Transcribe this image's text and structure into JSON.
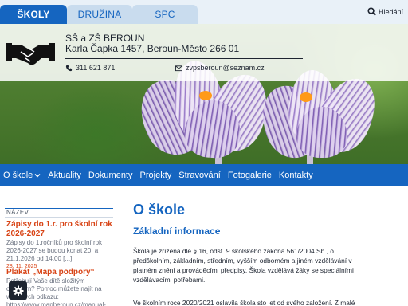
{
  "tabs": [
    {
      "label": "ŠKOLY",
      "active": true
    },
    {
      "label": "DRUŽINA",
      "active": false
    },
    {
      "label": "SPC",
      "active": false
    }
  ],
  "search": {
    "label": "Hledání",
    "icon": "search-icon"
  },
  "header": {
    "name": "SŠ a ZŠ BEROUN",
    "address": "Karla Čapka 1457, Beroun-Město 266 01",
    "phone": "311 621 871",
    "email": "zvpsberoun@seznam.cz",
    "logo_icon": "handshake-icon"
  },
  "nav": [
    {
      "label": "O škole",
      "has_dropdown": true
    },
    {
      "label": "Aktuality"
    },
    {
      "label": "Dokumenty"
    },
    {
      "label": "Projekty"
    },
    {
      "label": "Stravování"
    },
    {
      "label": "Fotogalerie"
    },
    {
      "label": "Kontakty"
    }
  ],
  "sidebar": {
    "header": "NÁZEV",
    "news": [
      {
        "title": "Zápisy do 1.r. pro školní rok 2026-2027",
        "text": "Zápisy do 1.ročníků pro školní rok 2026-2027 se budou konat 20. a 21.1.2026 od 14.00 [...]",
        "date": "28. 11. 2025"
      },
      {
        "title": "Plakát „Mapa podpory“",
        "text": "Potřebují Vaše dítě složitým obdobím? Pomoc můžete najít na webových odkazu: https://www.mapberoun.cz/manual-"
      }
    ]
  },
  "main": {
    "title": "O škole",
    "subtitle": "Základní informace",
    "p1": "Škola je zřízena dle § 16, odst. 9 školského zákona 561/2004 Sb., o předškolním, základním, středním, vyšším odborném a jiném vzdělávání v platném znění a prováděcími předpisy. Škola vzdělává žáky se speciálními vzdělávacími potřebami.",
    "p2": "Ve školním roce 2020/2021 oslavila škola sto let od svého založení. Z malé"
  },
  "accessibility_button": {
    "icon": "gear-icon"
  },
  "colors": {
    "accent": "#1565c0",
    "news_title": "#d84315",
    "nav_bg": "#1565c0"
  }
}
